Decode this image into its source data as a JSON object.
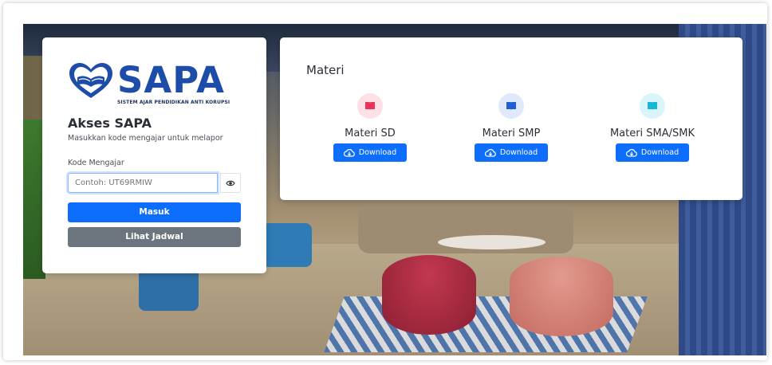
{
  "brand": {
    "name": "SAPA",
    "tagline": "SISTEM AJAR PENDIDIKAN ANTI KORUPSI"
  },
  "login": {
    "title": "Akses SAPA",
    "subtitle": "Masukkan kode mengajar untuk melapor",
    "field_label": "Kode Mengajar",
    "field_placeholder": "Contoh: UT69RMIW",
    "field_value": "",
    "submit_label": "Masuk",
    "schedule_label": "Lihat Jadwal"
  },
  "materi": {
    "title": "Materi",
    "items": [
      {
        "label": "Materi SD",
        "button": "Download",
        "icon": "book-icon",
        "icon_color": "#e8335a",
        "icon_bg": "#fde1e7"
      },
      {
        "label": "Materi SMP",
        "button": "Download",
        "icon": "book-icon",
        "icon_color": "#1f5fd1",
        "icon_bg": "#dfe9fb"
      },
      {
        "label": "Materi SMA/SMK",
        "button": "Download",
        "icon": "book-icon",
        "icon_color": "#19b6d2",
        "icon_bg": "#d9f5fa"
      }
    ]
  },
  "colors": {
    "primary": "#0d6efd",
    "secondary": "#6c757d",
    "brand_blue": "#1d4da8"
  }
}
